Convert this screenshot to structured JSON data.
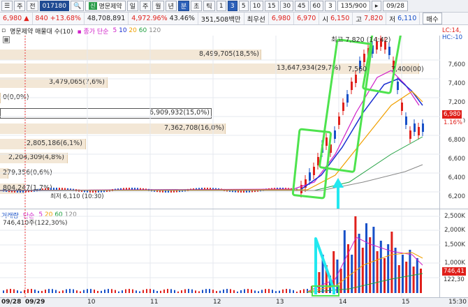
{
  "toolbar": {
    "menu_main": "주",
    "menu_prev": "전",
    "stock_code": "017180",
    "new_tag": "신",
    "stock_name": "명문제약",
    "period_labels": [
      "일",
      "주",
      "월",
      "년",
      "분",
      "초",
      "틱"
    ],
    "minute_options": [
      "1",
      "3",
      "5",
      "10",
      "15",
      "30",
      "45",
      "60"
    ],
    "active_minute": "3",
    "interval_value": "3",
    "range": "135/900",
    "date": "09/28"
  },
  "quote": {
    "price": "6,980",
    "change": "840",
    "change_pct": "+13.68%",
    "volume": "48,708,891",
    "volume_pct": "4,972.96%",
    "turnover_pct": "43.46%",
    "amount": "351,508백만",
    "best_label": "최우선",
    "ask": "6,980",
    "bid": "6,970",
    "open_label": "시",
    "open": "6,150",
    "high_label": "고",
    "high": "7,820",
    "low_label": "저",
    "low": "6,110",
    "order_button": "매수"
  },
  "price_pane": {
    "title": "명문제약 매물대 수(10)",
    "ma_label": "종가 단순",
    "ma_periods": [
      "5",
      "10",
      "20",
      "60",
      "120"
    ],
    "ma_colors": [
      "#d020c8",
      "#1a2fd0",
      "#f0a000",
      "#20a040",
      "#888888"
    ],
    "high_note": "최고 7,820 (14:42)",
    "low_note": "최저 6,110 (10:30)",
    "lc_label": "LC:14,",
    "hc_label": "HC:-10",
    "y_ticks": [
      "7,600",
      "7,400",
      "7,200",
      "7,000",
      "6,800",
      "6,600",
      "6,400",
      "6,200"
    ],
    "current_tag": "6,980",
    "current_pct": "1.16%",
    "volume_profile": [
      {
        "label": "8,499,705(18,5%)",
        "fraction": 0.185
      },
      {
        "label": "13,647,934(29,7%)",
        "fraction": 0.297
      },
      {
        "label": "3,479,065(7,6%)",
        "fraction": 0.076
      },
      {
        "label": "0(0,0%)",
        "fraction": 0.0
      },
      {
        "label": "6,909,932(15,0%)",
        "fraction": 0.15
      },
      {
        "label": "7,362,708(16,0%)",
        "fraction": 0.16
      },
      {
        "label": "2,805,186(6,1%)",
        "fraction": 0.061
      },
      {
        "label": "2,204,309(4,8%)",
        "fraction": 0.048
      },
      {
        "label": "279,356(0,6%)",
        "fraction": 0.006
      },
      {
        "label": "804,247(1,7%)",
        "fraction": 0.017
      }
    ],
    "overlay_labels": [
      "7,560",
      "7,400(00)"
    ]
  },
  "volume_pane": {
    "title": "거래량",
    "ma_label": "단순",
    "ma_periods": [
      "5",
      "20",
      "60",
      "120"
    ],
    "value": "746,410주(122,30%)",
    "y_ticks": [
      "2,500K",
      "2,000K",
      "1,500K",
      "1,000K",
      "500K"
    ],
    "current_tag": "746,41",
    "current_pct": "122,30"
  },
  "x_axis": [
    "09/28",
    "09/29",
    "10",
    "11",
    "12",
    "13",
    "14",
    "15"
  ],
  "x_axis_end": "15:30"
}
